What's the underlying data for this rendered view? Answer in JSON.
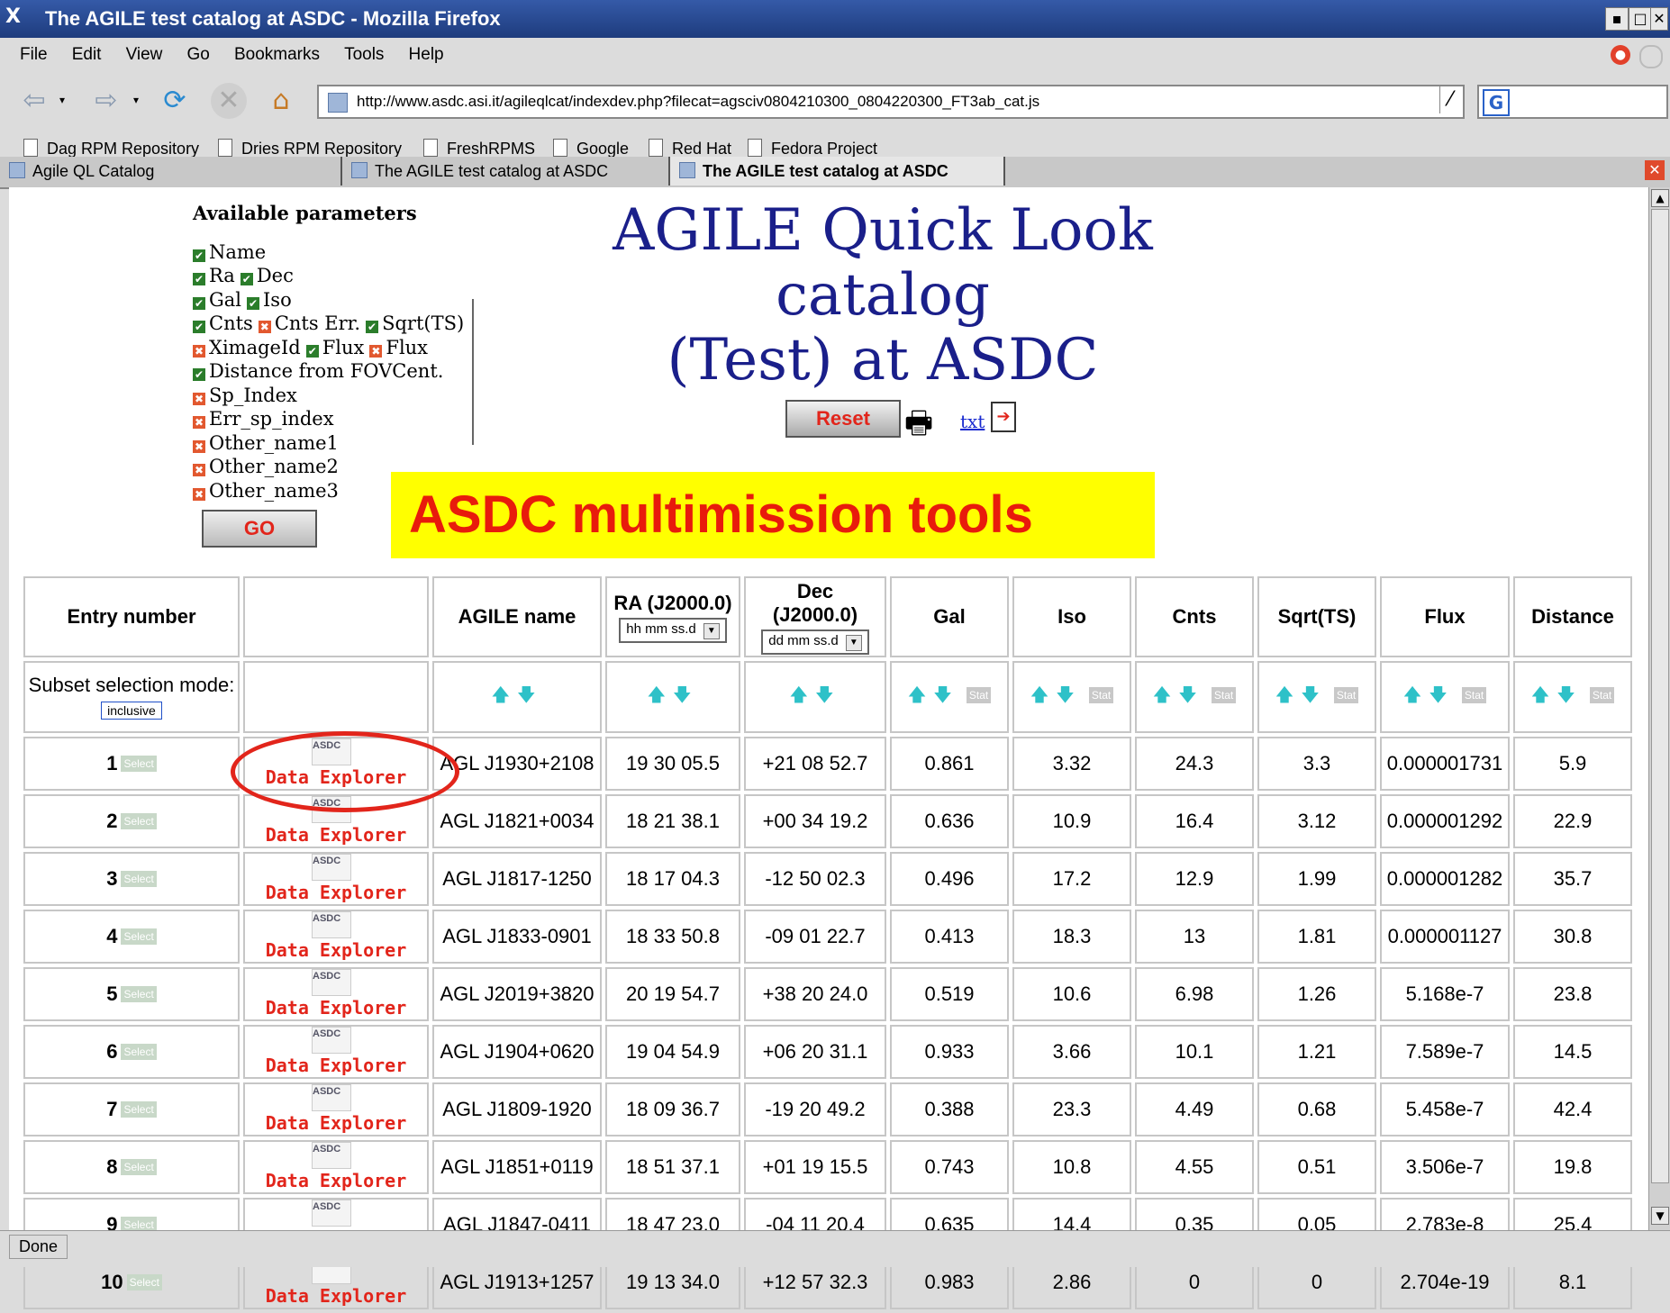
{
  "window": {
    "title": "The AGILE test catalog at ASDC - Mozilla Firefox"
  },
  "menu": [
    "File",
    "Edit",
    "View",
    "Go",
    "Bookmarks",
    "Tools",
    "Help"
  ],
  "url": "http://www.asdc.asi.it/agileqlcat/indexdev.php?filecat=agsciv0804210300_0804220300_FT3ab_cat.js",
  "search_engine_icon": "G",
  "bookmarks": [
    "Dag RPM Repository",
    "Dries RPM Repository",
    "FreshRPMS",
    "Google",
    "Red Hat",
    "Fedora Project"
  ],
  "tabs": [
    {
      "label": "Agile QL Catalog",
      "active": false
    },
    {
      "label": "The AGILE test catalog at ASDC",
      "active": false
    },
    {
      "label": "The AGILE test catalog at ASDC",
      "active": true
    }
  ],
  "params": {
    "header": "Available parameters",
    "lines": [
      [
        {
          "on": true,
          "label": "Name"
        }
      ],
      [
        {
          "on": true,
          "label": "Ra"
        },
        {
          "on": true,
          "label": "Dec"
        }
      ],
      [
        {
          "on": true,
          "label": "Gal"
        },
        {
          "on": true,
          "label": "Iso"
        }
      ],
      [
        {
          "on": true,
          "label": "Cnts"
        },
        {
          "on": false,
          "label": "Cnts Err."
        },
        {
          "on": true,
          "label": "Sqrt(TS)"
        }
      ],
      [
        {
          "on": false,
          "label": "XimageId"
        },
        {
          "on": true,
          "label": "Flux"
        },
        {
          "on": false,
          "label": "Flux"
        }
      ],
      [
        {
          "on": true,
          "label": "Distance from FOVCent."
        }
      ],
      [
        {
          "on": false,
          "label": "Sp_Index"
        }
      ],
      [
        {
          "on": false,
          "label": "Err_sp_index"
        }
      ],
      [
        {
          "on": false,
          "label": "Other_name1"
        }
      ],
      [
        {
          "on": false,
          "label": "Other_name2"
        }
      ],
      [
        {
          "on": false,
          "label": "Other_name3"
        }
      ]
    ],
    "go_label": "GO"
  },
  "title_line1": "AGILE Quick Look catalog",
  "title_line2": "(Test) at ASDC",
  "reset_label": "Reset",
  "txt_label": "txt",
  "banner": "ASDC multimission tools",
  "table": {
    "headers": {
      "entry": "Entry number",
      "name": "AGILE name",
      "ra": "RA (J2000.0)",
      "ra_format": "hh mm ss.d",
      "dec_line1": "Dec",
      "dec_line2": "(J2000.0)",
      "dec_format": "dd mm ss.d",
      "gal": "Gal",
      "iso": "Iso",
      "cnts": "Cnts",
      "sqrt": "Sqrt(TS)",
      "flux": "Flux",
      "distance": "Distance"
    },
    "subset_label": "Subset selection mode:",
    "subset_mode": "inclusive",
    "stat_label": "Stat",
    "select_label": "Select",
    "explorer_label": "Data Explorer",
    "asdc_logo": "ASDC",
    "rows": [
      {
        "n": "1",
        "name": "AGL J1930+2108",
        "ra": "19 30 05.5",
        "dec": "+21 08 52.7",
        "gal": "0.861",
        "iso": "3.32",
        "cnts": "24.3",
        "sqrt": "3.3",
        "flux": "0.000001731",
        "dist": "5.9"
      },
      {
        "n": "2",
        "name": "AGL J1821+0034",
        "ra": "18 21 38.1",
        "dec": "+00 34 19.2",
        "gal": "0.636",
        "iso": "10.9",
        "cnts": "16.4",
        "sqrt": "3.12",
        "flux": "0.000001292",
        "dist": "22.9"
      },
      {
        "n": "3",
        "name": "AGL J1817-1250",
        "ra": "18 17 04.3",
        "dec": "-12 50 02.3",
        "gal": "0.496",
        "iso": "17.2",
        "cnts": "12.9",
        "sqrt": "1.99",
        "flux": "0.000001282",
        "dist": "35.7"
      },
      {
        "n": "4",
        "name": "AGL J1833-0901",
        "ra": "18 33 50.8",
        "dec": "-09 01 22.7",
        "gal": "0.413",
        "iso": "18.3",
        "cnts": "13",
        "sqrt": "1.81",
        "flux": "0.000001127",
        "dist": "30.8"
      },
      {
        "n": "5",
        "name": "AGL J2019+3820",
        "ra": "20 19 54.7",
        "dec": "+38 20 24.0",
        "gal": "0.519",
        "iso": "10.6",
        "cnts": "6.98",
        "sqrt": "1.26",
        "flux": "5.168e-7",
        "dist": "23.8"
      },
      {
        "n": "6",
        "name": "AGL J1904+0620",
        "ra": "19 04 54.9",
        "dec": "+06 20 31.1",
        "gal": "0.933",
        "iso": "3.66",
        "cnts": "10.1",
        "sqrt": "1.21",
        "flux": "7.589e-7",
        "dist": "14.5"
      },
      {
        "n": "7",
        "name": "AGL J1809-1920",
        "ra": "18 09 36.7",
        "dec": "-19 20 49.2",
        "gal": "0.388",
        "iso": "23.3",
        "cnts": "4.49",
        "sqrt": "0.68",
        "flux": "5.458e-7",
        "dist": "42.4"
      },
      {
        "n": "8",
        "name": "AGL J1851+0119",
        "ra": "18 51 37.1",
        "dec": "+01 19 15.5",
        "gal": "0.743",
        "iso": "10.8",
        "cnts": "4.55",
        "sqrt": "0.51",
        "flux": "3.506e-7",
        "dist": "19.8"
      },
      {
        "n": "9",
        "name": "AGL J1847-0411",
        "ra": "18 47 23.0",
        "dec": "-04 11 20.4",
        "gal": "0.635",
        "iso": "14.4",
        "cnts": "0.35",
        "sqrt": "0.05",
        "flux": "2.783e-8",
        "dist": "25.4"
      },
      {
        "n": "10",
        "name": "AGL J1913+1257",
        "ra": "19 13 34.0",
        "dec": "+12 57 32.3",
        "gal": "0.983",
        "iso": "2.86",
        "cnts": "0",
        "sqrt": "0",
        "flux": "2.704e-19",
        "dist": "8.1"
      }
    ]
  },
  "status": "Done",
  "colors": {
    "banner_bg": "#ffff00",
    "banner_text": "#e81b0c",
    "title": "#1a1f8a",
    "highlight_circle": "#e2251b",
    "sort_arrows": "#2ec1c8"
  }
}
